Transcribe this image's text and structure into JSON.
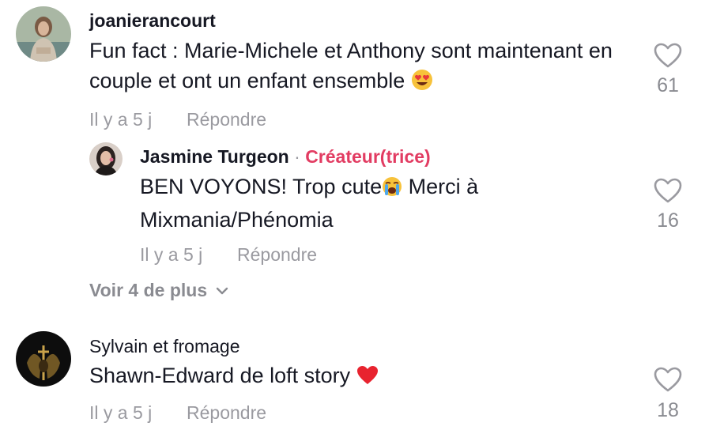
{
  "comments": [
    {
      "username": "joanierancourt",
      "text": "Fun fact : Marie-Michele et Anthony sont maintenant en couple et ont un enfant ensemble",
      "emoji": "heart-eyes-emoji",
      "time": "Il y a 5 j",
      "reply_label": "Répondre",
      "likes": "61",
      "replies": [
        {
          "username": "Jasmine Turgeon",
          "separator": "·",
          "badge": "Créateur(trice)",
          "text_a": "BEN VOYONS! Trop cute",
          "emoji": "crying-emoji",
          "text_b": "Merci à Mixmania/Phénomia",
          "time": "Il y a 5 j",
          "reply_label": "Répondre",
          "likes": "16"
        }
      ],
      "view_more": "Voir 4 de plus"
    },
    {
      "username": "Sylvain et fromage",
      "text": "Shawn-Edward de loft story",
      "emoji": "red-heart-emoji",
      "time": "Il y a 5 j",
      "reply_label": "Répondre",
      "likes": "18"
    }
  ],
  "colors": {
    "creator_badge": "#e23c62",
    "muted": "#9a9aa0"
  }
}
